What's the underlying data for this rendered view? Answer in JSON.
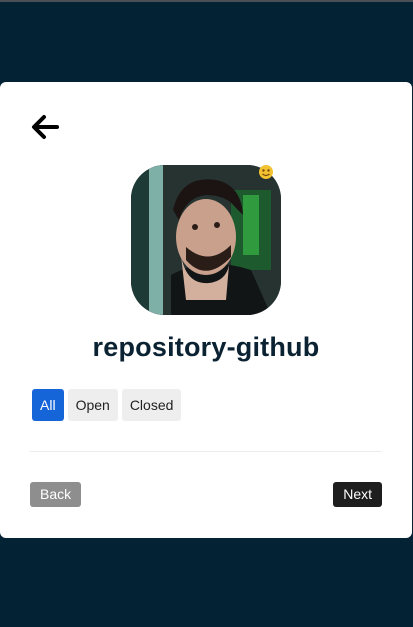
{
  "header": {
    "back_icon": "arrow-left-icon"
  },
  "profile": {
    "avatar_icon": "user-avatar-photo",
    "badge_icon": "emoji-badge-icon",
    "repo_name": "repository-github"
  },
  "filters": {
    "options": [
      {
        "label": "All",
        "active": true
      },
      {
        "label": "Open",
        "active": false
      },
      {
        "label": "Closed",
        "active": false
      }
    ]
  },
  "footer": {
    "back_label": "Back",
    "next_label": "Next"
  },
  "colors": {
    "page_background": "#032233",
    "card_background": "#ffffff",
    "title_color": "#0b2233",
    "active_filter": "#1565d8",
    "inactive_filter": "#eeeeee",
    "back_button": "#8e8e8e",
    "next_button": "#1e1e1e"
  }
}
